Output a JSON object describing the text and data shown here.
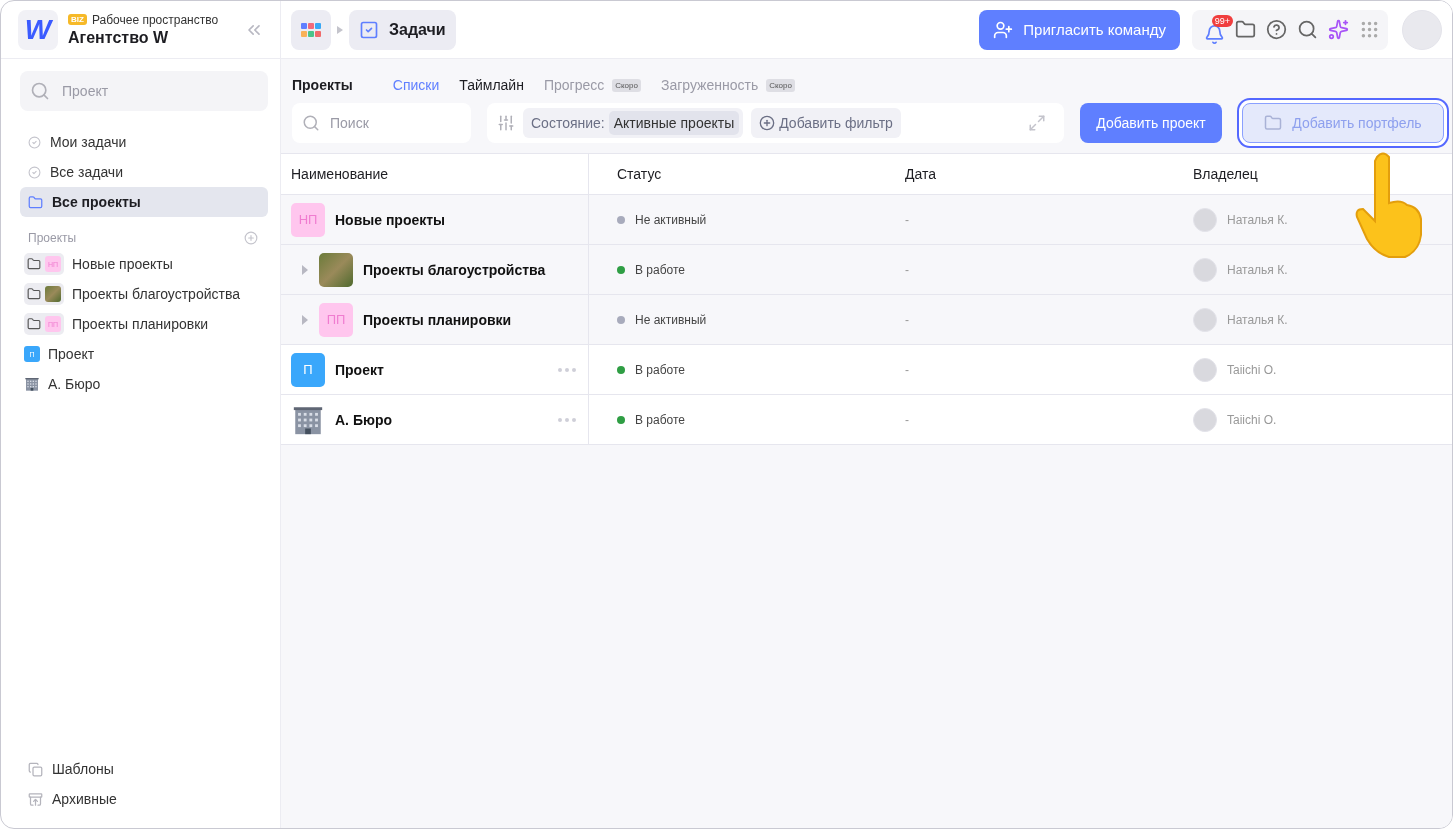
{
  "workspace": {
    "logo": "W",
    "badge": "BIZ",
    "label": "Рабочее пространство",
    "name": "Агентство W"
  },
  "sidebar": {
    "search": {
      "placeholder": "Проект"
    },
    "nav": [
      {
        "label": "Мои задачи",
        "kind": "check",
        "selected": false
      },
      {
        "label": "Все задачи",
        "kind": "check",
        "selected": false
      },
      {
        "label": "Все проекты",
        "kind": "folder",
        "selected": true
      }
    ],
    "projects_header": "Проекты",
    "projects": [
      {
        "label": "Новые проекты",
        "kind": "portfolio",
        "thumb": {
          "kind": "initials",
          "text": "НП",
          "color": "#ffc6ee"
        }
      },
      {
        "label": "Проекты благоустройства",
        "kind": "portfolio",
        "thumb": {
          "kind": "photo"
        }
      },
      {
        "label": "Проекты планировки",
        "kind": "portfolio",
        "thumb": {
          "kind": "initials",
          "text": "ПП",
          "color": "#ffc6ee"
        }
      },
      {
        "label": "Проект",
        "kind": "project",
        "thumb": {
          "kind": "initials",
          "text": "П",
          "color": "#3aa7fb"
        }
      },
      {
        "label": "А. Бюро",
        "kind": "project",
        "thumb": {
          "kind": "building"
        }
      }
    ],
    "footer": [
      {
        "label": "Шаблоны",
        "kind": "templates"
      },
      {
        "label": "Архивные",
        "kind": "archive"
      }
    ]
  },
  "topbar": {
    "breadcrumb": "Задачи",
    "invite_button": "Пригласить команду",
    "notification_count": "99+"
  },
  "view": {
    "title": "Проекты",
    "tabs": [
      {
        "label": "Списки",
        "selected": true,
        "disabled": false
      },
      {
        "label": "Таймлайн",
        "selected": false,
        "disabled": false
      },
      {
        "label": "Прогресс",
        "selected": false,
        "disabled": true,
        "badge": "Скоро"
      },
      {
        "label": "Загруженность",
        "selected": false,
        "disabled": true,
        "badge": "Скоро"
      }
    ],
    "search": {
      "placeholder": "Поиск"
    },
    "filter": {
      "label": "Состояние:",
      "value": "Активные проекты"
    },
    "add_filter": "Добавить фильтр",
    "buttons": [
      {
        "label": "Добавить проект",
        "kind": "primary",
        "focused": false
      },
      {
        "label": "Добавить портфель",
        "kind": "ghost",
        "focused": true
      }
    ]
  },
  "table": {
    "columns": [
      "Наименование",
      "Статус",
      "Дата",
      "Владелец"
    ],
    "rows": [
      {
        "name": "Новые проекты",
        "kind": "portfolio",
        "thumb": {
          "kind": "initials",
          "text": "НП",
          "color": "#ffc6ee"
        },
        "status": {
          "label": "Не активный",
          "color": "#a8abbc"
        },
        "date": "-",
        "owner": "Наталья К.",
        "children": [
          {
            "name": "Проекты благоустройства",
            "kind": "portfolio",
            "expanded": false,
            "thumb": {
              "kind": "photo"
            },
            "status": {
              "label": "В работе",
              "color": "#2f9e44"
            },
            "date": "-",
            "owner": "Наталья К."
          },
          {
            "name": "Проекты планировки",
            "kind": "portfolio",
            "expanded": false,
            "thumb": {
              "kind": "initials",
              "text": "ПП",
              "color": "#ffc6ee"
            },
            "status": {
              "label": "Не активный",
              "color": "#a8abbc"
            },
            "date": "-",
            "owner": "Наталья К."
          }
        ]
      },
      {
        "name": "Проект",
        "kind": "project",
        "thumb": {
          "kind": "initials",
          "text": "П",
          "color": "#3aa7fb"
        },
        "status": {
          "label": "В работе",
          "color": "#2f9e44"
        },
        "date": "-",
        "owner": "Taiichi O."
      },
      {
        "name": "А. Бюро",
        "kind": "project",
        "thumb": {
          "kind": "building"
        },
        "status": {
          "label": "В работе",
          "color": "#2f9e44"
        },
        "date": "-",
        "owner": "Taiichi O."
      }
    ]
  }
}
